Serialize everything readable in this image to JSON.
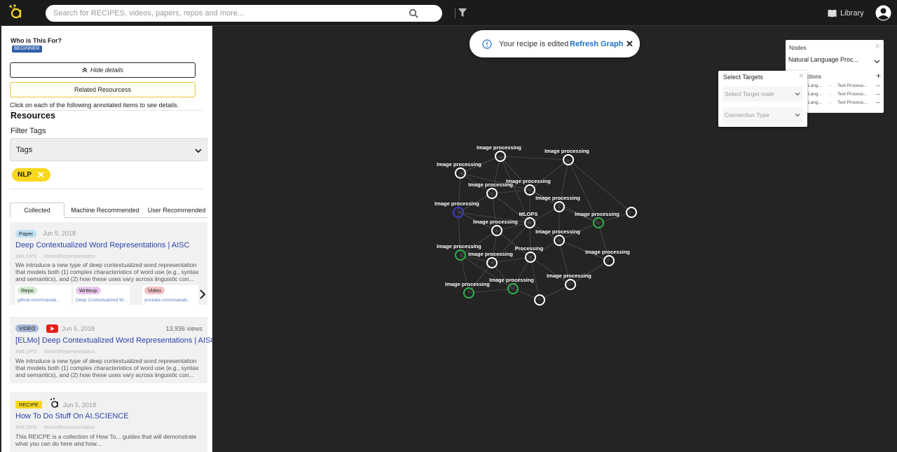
{
  "topbar": {
    "search_placeholder": "Search for RECIPES, videos, papers, repos and more...",
    "library_label": "Library"
  },
  "details": {
    "who_title": "Who is This For?",
    "level": "BEGINNER",
    "hide_details_label": "Hide details",
    "related_resources_label": "Related Resourcess",
    "instructions": "Click on each of the following annotated items to see details.",
    "resources_title": "Resources",
    "filter_tags_title": "Filter Tags",
    "tags_select_label": "Tags",
    "active_tag": "NLP"
  },
  "tabs": [
    "Collected",
    "Machine Recommended",
    "User Recommended"
  ],
  "cards": [
    {
      "type": "Paper",
      "date": "Jun 5, 2018",
      "title": "Deep Contextualized Word Representations | AISC",
      "hashtags": [
        "#MLOPS",
        "#WordRepresentation"
      ],
      "description": "We introduce a new type of deep contextualized word representation that models both (1) complex characteristics of word use (e.g., syntax and semantics), and (2) how these uses vary across linguistic con...",
      "links": [
        {
          "type": "Repo",
          "url": "github.com/noanab..."
        },
        {
          "type": "Writeup",
          "url": "Deep Contextualized W..."
        },
        {
          "type": "Video",
          "url": "youtube.com/noanab..."
        }
      ]
    },
    {
      "type": "VIDEO",
      "date": "Jun 5, 2018",
      "views": "13,936 views",
      "title": "[ELMo] Deep Contextualized Word Representations | AISC",
      "hashtags": [
        "#MLOPS",
        "#WordRepresentation"
      ],
      "description": "We introduce a new type of deep contextualized word representation that models both (1) complex characteristics of word use (e.g., syntax and semantics), and (2) how these uses vary across linguistic con..."
    },
    {
      "type": "RECIPE",
      "date": "Jun 5, 2018",
      "title": "How To Do Stuff On AI.SCIENCE",
      "hashtags": [
        "#MLOPS",
        "#WordRepresentation"
      ],
      "description": "This REICPE is a collection of How To... guides that will demonstrate what you can do here and how..."
    }
  ],
  "toast": {
    "message": "Your recipe is edited",
    "action": "Refresh Graph"
  },
  "nodes_panel": {
    "title": "Nodes",
    "selected_node": "Natural Language Proc...",
    "connections_title": "ctions",
    "connections": [
      {
        "source": "Lang...",
        "target": "Text Process..."
      },
      {
        "source": "Lang...",
        "target": "Text Process..."
      },
      {
        "source": "Lang...",
        "target": "Text Process..."
      }
    ]
  },
  "select_targets": {
    "title": "Select Targets",
    "target_node_placeholder": "Select Target node",
    "connection_type_placeholder": "Connection Type"
  },
  "graph": {
    "colors": {
      "default": "#ffffff",
      "selected": "#31b24a",
      "active": "#3a3ad0"
    },
    "nodes": [
      {
        "label": "Image processing",
        "state": "default"
      },
      {
        "label": "Image processing",
        "state": "default"
      },
      {
        "label": "Image processing",
        "state": "default"
      },
      {
        "label": "Image processing",
        "state": "default"
      },
      {
        "label": "Image processing",
        "state": "default"
      },
      {
        "label": "Image processing",
        "state": "active"
      },
      {
        "label": "Image processing",
        "state": "default"
      },
      {
        "label": "MLOPS",
        "state": "default"
      },
      {
        "label": "Image processing",
        "state": "default"
      },
      {
        "label": "Image processing",
        "state": "selected"
      },
      {
        "label": "",
        "state": "default"
      },
      {
        "label": "Image processing",
        "state": "default"
      },
      {
        "label": "Image processing",
        "state": "selected"
      },
      {
        "label": "Image processing",
        "state": "default"
      },
      {
        "label": "Processing",
        "state": "default"
      },
      {
        "label": "Image processing",
        "state": "default"
      },
      {
        "label": "Image processing",
        "state": "selected"
      },
      {
        "label": "Image processing",
        "state": "selected"
      },
      {
        "label": "Image processing",
        "state": "default"
      },
      {
        "label": "",
        "state": "default"
      }
    ]
  }
}
